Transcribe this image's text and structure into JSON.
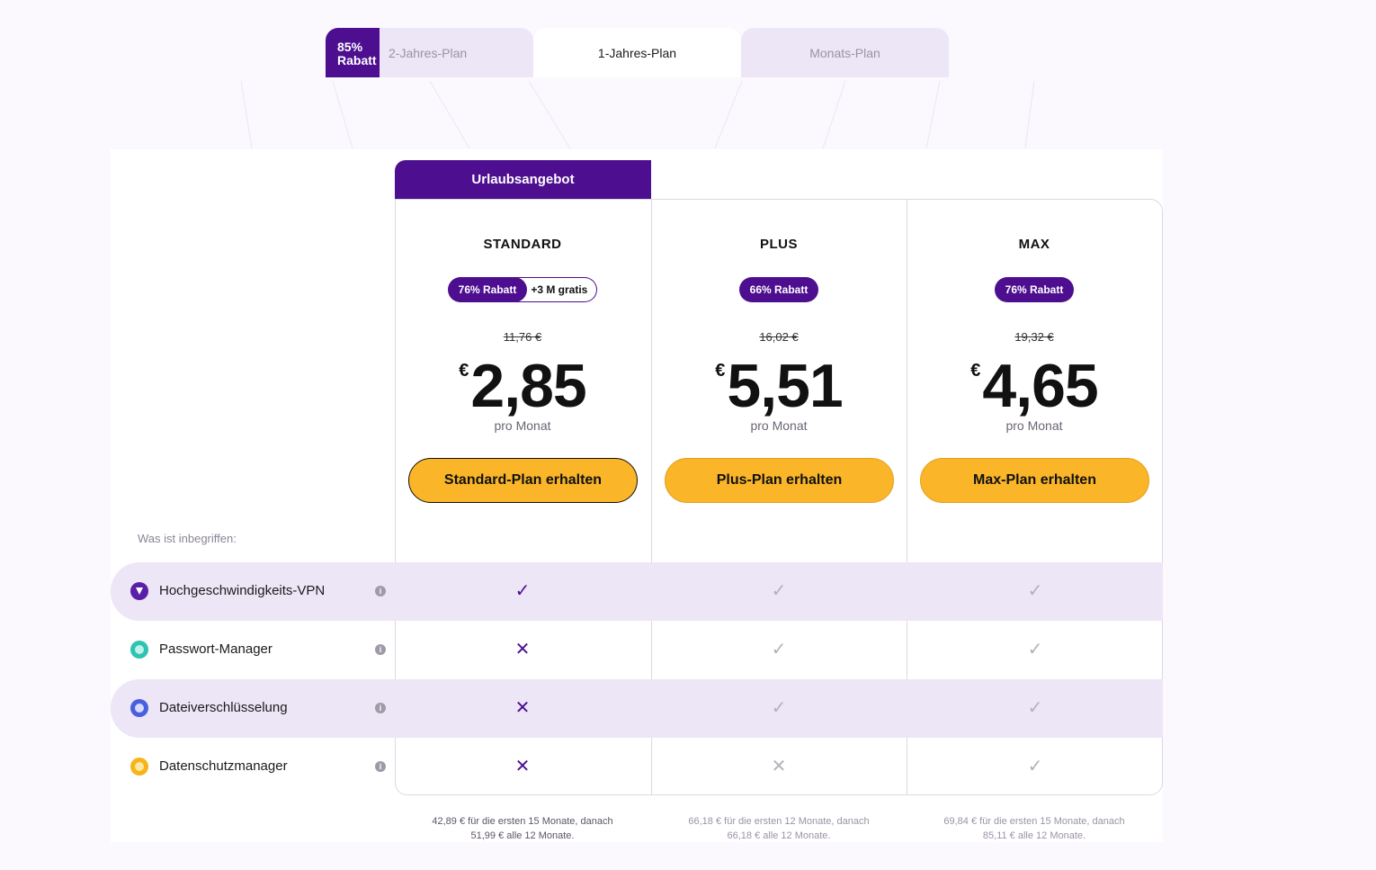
{
  "tabs": [
    {
      "label": "2-Jahres-Plan",
      "badge": "85% Rabatt"
    },
    {
      "label": "1-Jahres-Plan"
    },
    {
      "label": "Monats-Plan"
    }
  ],
  "promo_label": "Urlaubsangebot",
  "included_label": "Was ist inbegriffen:",
  "plans": [
    {
      "name": "STANDARD",
      "discount": "76% Rabatt",
      "extra": "+3 M gratis",
      "old_price": "11,76 €",
      "currency": "€",
      "price": "2,85",
      "per": "pro Monat",
      "cta": "Standard-Plan erhalten",
      "footnote_1": "42,89 € für die ersten 15 Monate, danach",
      "footnote_2": "51,99 € alle 12 Monate."
    },
    {
      "name": "PLUS",
      "discount": "66% Rabatt",
      "old_price": "16,02 €",
      "currency": "€",
      "price": "5,51",
      "per": "pro Monat",
      "cta": "Plus-Plan erhalten",
      "footnote_1": "66,18 € für die ersten 12 Monate, danach",
      "footnote_2": "66,18 € alle 12 Monate."
    },
    {
      "name": "MAX",
      "discount": "76% Rabatt",
      "old_price": "19,32 €",
      "currency": "€",
      "price": "4,65",
      "per": "pro Monat",
      "cta": "Max-Plan erhalten",
      "footnote_1": "69,84 € für die ersten 15 Monate, danach",
      "footnote_2": "85,11 € alle 12 Monate."
    }
  ],
  "features": [
    {
      "label": "Hochgeschwindigkeits-VPN",
      "icon": "vpn-shield-icon",
      "color": "#5a1fa8",
      "values": [
        "check",
        "check",
        "check"
      ]
    },
    {
      "label": "Passwort-Manager",
      "icon": "password-manager-icon",
      "color": "#2ec4b0",
      "values": [
        "cross",
        "check",
        "check"
      ]
    },
    {
      "label": "Dateiverschlüsselung",
      "icon": "file-encryption-icon",
      "color": "#4a5fe0",
      "values": [
        "cross",
        "check",
        "check"
      ]
    },
    {
      "label": "Datenschutzmanager",
      "icon": "privacy-manager-icon",
      "color": "#f5b519",
      "values": [
        "cross",
        "cross",
        "check"
      ]
    }
  ],
  "info_glyph": "i",
  "colors": {
    "brand": "#4d0e8f",
    "cta": "#fab528",
    "row_shade": "#ece6f6"
  }
}
